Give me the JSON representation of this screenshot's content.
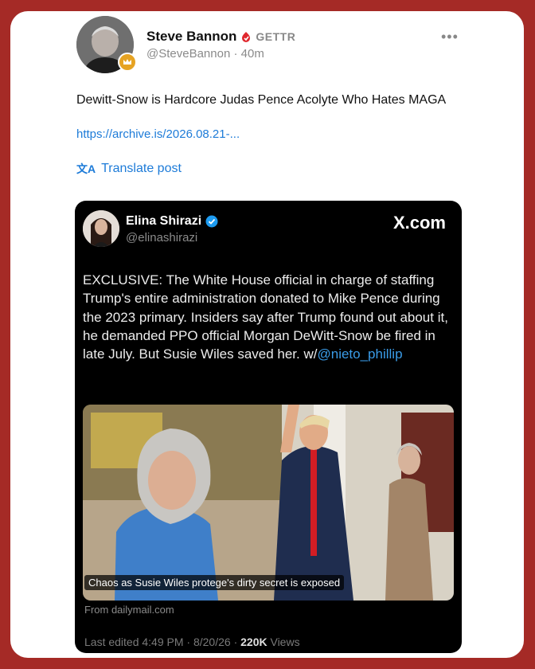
{
  "post": {
    "author_name": "Steve Bannon",
    "platform_label": "GETTR",
    "handle": "@SteveBannon",
    "separator": " · ",
    "age": "40m",
    "more_label": "•••",
    "text": "Dewitt-Snow is Hardcore Judas Pence Acolyte Who Hates MAGA",
    "link": "https://archive.is/2026.08.21-...",
    "translate_icon": "文A",
    "translate_label": "Translate post"
  },
  "embed": {
    "author_name": "Elina Shirazi",
    "handle": "@elinashirazi",
    "source": "X.com",
    "body_text": "EXCLUSIVE: The White House official in charge of staffing Trump's entire administration donated to Mike Pence during the 2023 primary. Insiders say after Trump found out about it, he demanded PPO official Morgan DeWitt-Snow be fired in late July. But Susie Wiles saved her. w/",
    "mention": "@nieto_phillip",
    "caption": "Chaos as Susie Wiles protege's dirty secret is exposed",
    "from": "From dailymail.com",
    "edited_label": "Last edited 4:49 PM · 8/20/26 · ",
    "views_count": "220K",
    "views_label": " Views"
  },
  "colors": {
    "frame_background": "#a52a26",
    "link": "#1d7bd8",
    "gettr_red": "#e0282e",
    "verified": "#1d9bf0",
    "mention": "#3a9ce8"
  },
  "icons": [
    "gettr-logo-icon",
    "more-options-icon",
    "translate-icon",
    "verified-badge-icon",
    "badge-icon"
  ]
}
